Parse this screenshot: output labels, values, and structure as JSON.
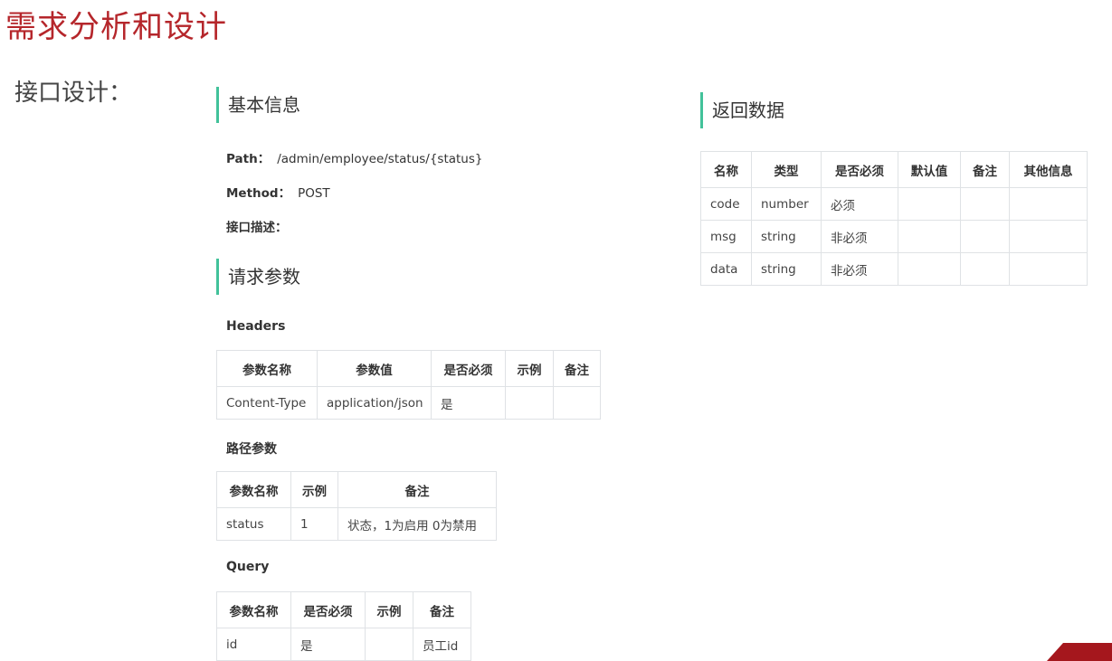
{
  "slide": {
    "title": "需求分析和设计",
    "section_label": "接口设计："
  },
  "basic": {
    "heading": "基本信息",
    "path_label": "Path：",
    "path_value": "/admin/employee/status/{status}",
    "method_label": "Method：",
    "method_value": "POST",
    "desc_label": "接口描述："
  },
  "request": {
    "heading": "请求参数",
    "headers": {
      "title": "Headers",
      "columns": [
        "参数名称",
        "参数值",
        "是否必须",
        "示例",
        "备注"
      ],
      "rows": [
        [
          "Content-Type",
          "application/json",
          "是",
          "",
          ""
        ]
      ]
    },
    "path_params": {
      "title": "路径参数",
      "columns": [
        "参数名称",
        "示例",
        "备注"
      ],
      "rows": [
        [
          "status",
          "1",
          "状态，1为启用 0为禁用"
        ]
      ]
    },
    "query": {
      "title": "Query",
      "columns": [
        "参数名称",
        "是否必须",
        "示例",
        "备注"
      ],
      "rows": [
        [
          "id",
          "是",
          "",
          "员工id"
        ]
      ]
    }
  },
  "response": {
    "heading": "返回数据",
    "columns": [
      "名称",
      "类型",
      "是否必须",
      "默认值",
      "备注",
      "其他信息"
    ],
    "rows": [
      [
        "code",
        "number",
        "必须",
        "",
        "",
        ""
      ],
      [
        "msg",
        "string",
        "非必须",
        "",
        "",
        ""
      ],
      [
        "data",
        "string",
        "非必须",
        "",
        "",
        ""
      ]
    ]
  },
  "colors": {
    "title_red": "#b5262b",
    "heading_accent": "#42c29a",
    "table_border": "#dfe2e5"
  }
}
